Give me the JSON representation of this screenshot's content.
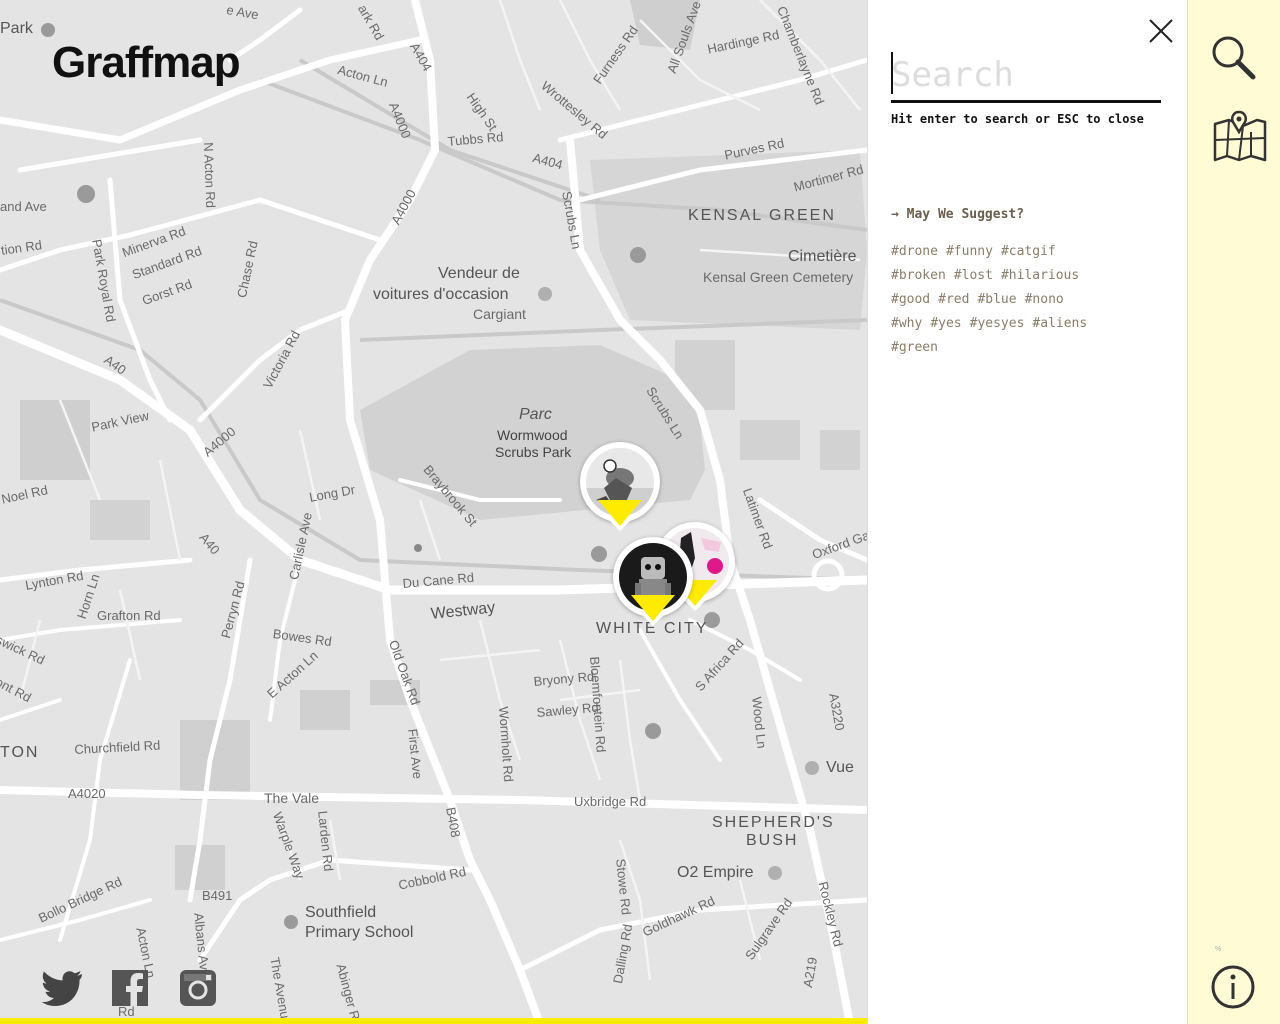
{
  "app": {
    "logo": "Graffmap"
  },
  "map": {
    "labels": {
      "park_top": "Park",
      "ave_top": "e Ave",
      "rk_rd": "ark Rd",
      "a404_a": "A404",
      "acton_ln": "Acton Ln",
      "high_st": "High St",
      "furness_rd": "Furness Rd",
      "all_souls": "All Souls Ave",
      "hardinge_rd": "Hardinge Rd",
      "chamberlayne": "Chamberlayne Rd",
      "wrottesley": "Wrottesley Rd",
      "a4000_a": "A4000",
      "tubbs_rd": "Tubbs Rd",
      "a404_b": "A404",
      "purves_rd": "Purves Rd",
      "mortimer_rd": "Mortimer Rd",
      "kensal_green": "KENSAL GREEN",
      "n_acton_rd": "N Acton Rd",
      "and_ave": "and Ave",
      "scrubs_ln_a": "Scrubs Ln",
      "cimetiere": "Cimetière",
      "kensal_cemetery": "Kensal Green Cemetery",
      "tion_rd": "tion Rd",
      "minerva_rd": "Minerva Rd",
      "standard_rd": "Standard Rd",
      "a4000_b": "A4000",
      "vendeur1": "Vendeur de",
      "vendeur2": "voitures d'occasion",
      "cargiant": "Cargiant",
      "park_royal_rd": "Park Royal Rd",
      "gorst_rd": "Gorst Rd",
      "chase_rd": "Chase Rd",
      "victoria_rd": "Victoria Rd",
      "a40_a": "A40",
      "scrubs_ln_b": "Scrubs Ln",
      "parc": "Parc",
      "wormwood": "Wormwood",
      "scrubs_park": "Scrubs Park",
      "park_view": "Park View",
      "a4000_c": "A4000",
      "noel_rd": "Noel Rd",
      "long_dr": "Long Dr",
      "braybrook": "Braybrook St",
      "latimer_rd": "Latimer Rd",
      "oxford_ga": "Oxford Ga",
      "a40_b": "A40",
      "carlisle": "Carlisle Ave",
      "lynton_rd": "Lynton Rd",
      "horn_ln": "Horn Ln",
      "du_cane": "Du Cane Rd",
      "grafton_rd": "Grafton Rd",
      "westway": "Westway",
      "white_city": "WHITE CITY",
      "bowes_rd": "Bowes Rd",
      "swick_rd": "swick Rd",
      "perryn_rd": "Perryn Rd",
      "e_acton_ln": "E Acton Ln",
      "old_oak_rd": "Old Oak Rd",
      "bryony_rd": "Bryony Rd",
      "bloemfontein": "Bloemfontein Rd",
      "s_africa": "S Africa Rd",
      "ont_rd": "ont Rd",
      "sawley_rd": "Sawley Rd",
      "a3220": "A3220",
      "wormholt_rd": "Wormholt Rd",
      "wood_ln": "Wood Ln",
      "ton": "TON",
      "churchfield": "Churchfield Rd",
      "first_ave": "First Ave",
      "vue": "Vue",
      "a4020": "A4020",
      "the_vale": "The Vale",
      "uxbridge_rd": "Uxbridge Rd",
      "shepherds1": "SHEPHERD'S",
      "shepherds2": "BUSH",
      "warple_way": "Warple Way",
      "larden_rd": "Larden Rd",
      "b408": "B408",
      "o2_empire": "O2 Empire",
      "stowe_rd": "Stowe Rd",
      "cobbold_rd": "Cobbold Rd",
      "rockley_rd": "Rockley Rd",
      "bollo_bridge": "Bollo Bridge Rd",
      "b491": "B491",
      "southfield1": "Southfield",
      "southfield2": "Primary School",
      "goldhawk_rd": "Goldhawk Rd",
      "sulgrave_rd": "Sulgrave Rd",
      "acton_ln_b": "Acton Ln",
      "albans_ave": "Albans Ave",
      "the_avenue": "The Avenue",
      "abinger_rd": "Abinger Rd",
      "dalling_rd": "Dalling Rd",
      "a219": "A219",
      "rd_bottom": "Rd"
    }
  },
  "social": {
    "twitter": "twitter-icon",
    "facebook": "facebook-icon",
    "instagram": "instagram-icon"
  },
  "search": {
    "placeholder": "Search",
    "value": "",
    "hint": "Hit enter to search or ESC to close",
    "suggest_title": "→ May We Suggest?",
    "tags": [
      [
        "#drone",
        "#funny",
        "#catgif"
      ],
      [
        "#broken",
        "#lost",
        "#hilarious"
      ],
      [
        "#good",
        "#red",
        "#blue",
        "#nono"
      ],
      [
        "#why",
        "#yes",
        "#yesyes",
        "#aliens"
      ],
      [
        "#green"
      ]
    ]
  },
  "rail": {
    "icons": [
      "search-icon",
      "map-icon",
      "info-icon"
    ],
    "tiny_mark": "%"
  },
  "colors": {
    "accent": "#ffeb00",
    "rail_bg": "#fffbd4",
    "tag": "#8a7d68",
    "map_bg": "#e6e6e6"
  }
}
